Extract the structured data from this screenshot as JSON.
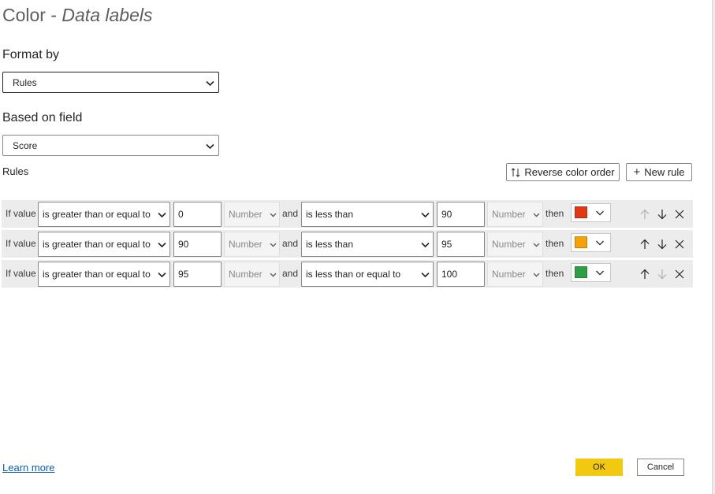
{
  "dialog": {
    "title_prefix": "Color - ",
    "title_italic": "Data labels"
  },
  "format_by": {
    "label": "Format by",
    "value": "Rules"
  },
  "based_on": {
    "label": "Based on field",
    "value": "Score"
  },
  "rules": {
    "label": "Rules",
    "reverse_label": "Reverse color order",
    "new_rule_label": "New rule",
    "items": [
      {
        "if_label": "If value",
        "op1": "is greater than or equal to",
        "val1": "0",
        "unit1": "Number",
        "and_label": "and",
        "op2": "is less than",
        "val2": "90",
        "unit2": "Number",
        "then_label": "then",
        "color": "#e03a14",
        "up_enabled": false,
        "down_enabled": true
      },
      {
        "if_label": "If value",
        "op1": "is greater than or equal to",
        "val1": "90",
        "unit1": "Number",
        "and_label": "and",
        "op2": "is less than",
        "val2": "95",
        "unit2": "Number",
        "then_label": "then",
        "color": "#f5a20a",
        "up_enabled": true,
        "down_enabled": true
      },
      {
        "if_label": "If value",
        "op1": "is greater than or equal to",
        "val1": "95",
        "unit1": "Number",
        "and_label": "and",
        "op2": "is less than or equal to",
        "val2": "100",
        "unit2": "Number",
        "then_label": "then",
        "color": "#2ea043",
        "up_enabled": true,
        "down_enabled": false
      }
    ]
  },
  "footer": {
    "learn_more": "Learn more",
    "ok": "OK",
    "cancel": "Cancel"
  },
  "colors": {
    "accent": "#f2c811",
    "link": "#0e5aa7",
    "row_bg": "#ececec"
  }
}
